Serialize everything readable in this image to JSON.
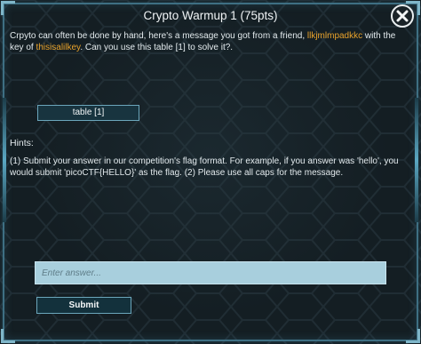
{
  "dialog": {
    "title": "Crypto Warmup 1 (75pts)",
    "close_icon": "close-x-icon"
  },
  "description": {
    "part1": "Crpyto can often be done by hand, here's a message you got from a friend,",
    "message": "llkjmlmpadkkc",
    "part2": "with the key of",
    "key": "thisisalilkey",
    "part3": ". Can you use this table [1]  to solve it?."
  },
  "table_link": {
    "label": "table [1]"
  },
  "hints": {
    "heading": "Hints:",
    "text": "(1) Submit your answer in our competition's flag format. For example, if you answer was 'hello', you would submit 'picoCTF{HELLO}' as the flag. (2) Please use all caps for the message."
  },
  "answer": {
    "placeholder": "Enter answer...",
    "value": ""
  },
  "submit": {
    "label": "Submit"
  },
  "colors": {
    "accent": "#e8a22b",
    "frame": "#3e6f83",
    "input_bg": "#a8cfdd",
    "button_bg": "#13313c"
  }
}
